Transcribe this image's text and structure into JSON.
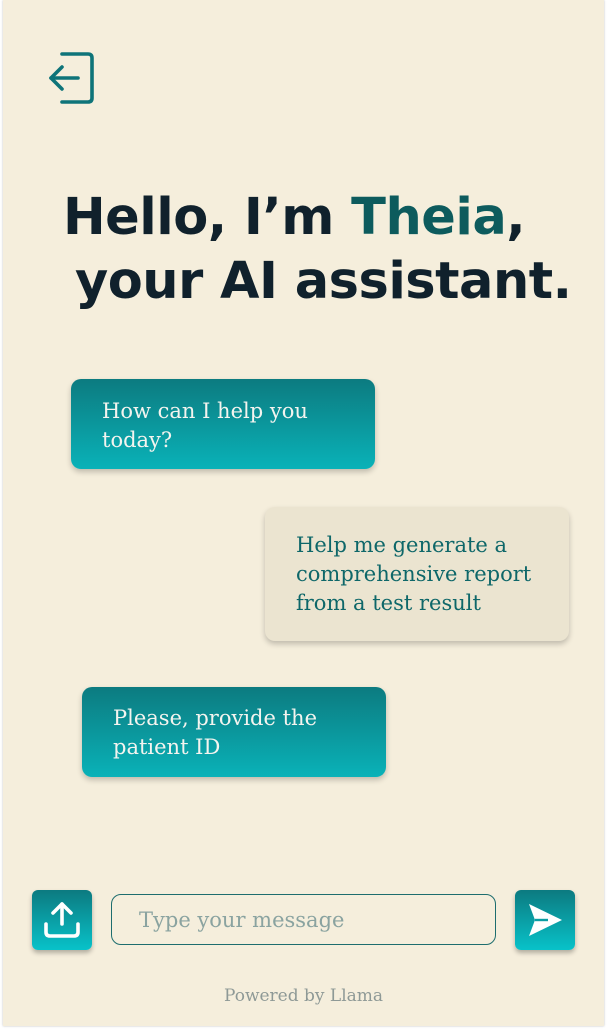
{
  "header": {
    "logout_icon": "logout-icon"
  },
  "greeting": {
    "prefix": "Hello, I’m ",
    "name": "Theia",
    "comma": ",",
    "line2": "your AI assistant."
  },
  "messages": [
    {
      "role": "assistant",
      "text": "How can I help you today?"
    },
    {
      "role": "user",
      "text": "Help me generate a comprehensive report from a test result"
    },
    {
      "role": "assistant",
      "text": "Please, provide the patient ID"
    }
  ],
  "composer": {
    "upload_icon": "upload-icon",
    "input_value": "",
    "input_placeholder": "Type your message",
    "send_icon": "send-icon"
  },
  "footer": {
    "text": "Powered by Llama"
  },
  "colors": {
    "background": "#f5eedc",
    "accent": "#0d5b5d",
    "bubble_ai_top": "#0c7b80",
    "bubble_ai_bottom": "#0ab2b8",
    "bubble_user": "#ebe4d0",
    "heading": "#10212c"
  }
}
